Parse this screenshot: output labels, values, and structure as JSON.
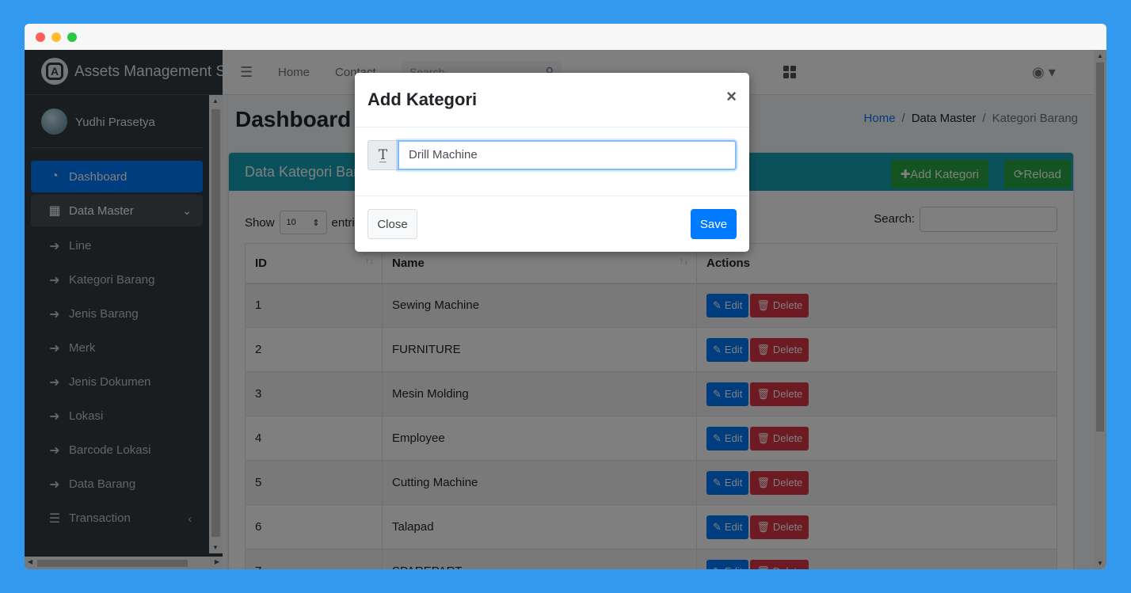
{
  "brand": {
    "title": "Assets Management Sys",
    "logo_letter": "A"
  },
  "user": {
    "name": "Yudhi Prasetya"
  },
  "sidebar": {
    "items": [
      {
        "label": "Dashboard",
        "icon": "tachometer-icon"
      },
      {
        "label": "Data Master",
        "icon": "table-icon"
      },
      {
        "label": "Line",
        "icon": "arrow-right-icon"
      },
      {
        "label": "Kategori Barang",
        "icon": "arrow-right-icon"
      },
      {
        "label": "Jenis Barang",
        "icon": "arrow-right-icon"
      },
      {
        "label": "Merk",
        "icon": "arrow-right-icon"
      },
      {
        "label": "Jenis Dokumen",
        "icon": "arrow-right-icon"
      },
      {
        "label": "Lokasi",
        "icon": "arrow-right-icon"
      },
      {
        "label": "Barcode Lokasi",
        "icon": "arrow-right-icon"
      },
      {
        "label": "Data Barang",
        "icon": "arrow-right-icon"
      },
      {
        "label": "Transaction",
        "icon": "list-icon"
      }
    ]
  },
  "topnav": {
    "home": "Home",
    "contact": "Contact",
    "search_placeholder": "Search"
  },
  "page": {
    "title": "Dashboard"
  },
  "breadcrumb": {
    "home": "Home",
    "sep": "/",
    "data_master": "Data Master",
    "current": "Kategori Barang"
  },
  "card": {
    "title": "Data Kategori Barang",
    "add_label": "Add Kategori",
    "reload_label": "Reload",
    "show": "Show",
    "entries_value": "10",
    "entries_suffix": "entries",
    "search_label": "Search:"
  },
  "table": {
    "headers": [
      "ID",
      "Name",
      "Actions"
    ],
    "edit_label": "Edit",
    "delete_label": "Delete",
    "rows": [
      {
        "id": "1",
        "name": "Sewing Machine"
      },
      {
        "id": "2",
        "name": "FURNITURE"
      },
      {
        "id": "3",
        "name": "Mesin Molding"
      },
      {
        "id": "4",
        "name": "Employee"
      },
      {
        "id": "5",
        "name": "Cutting Machine"
      },
      {
        "id": "6",
        "name": "Talapad"
      },
      {
        "id": "7",
        "name": "SPAREPART"
      }
    ]
  },
  "modal": {
    "title": "Add Kategori",
    "close_x": "×",
    "input_value": "Drill Machine",
    "close_label": "Close",
    "save_label": "Save"
  },
  "colors": {
    "sidebar_bg": "#343a40",
    "primary": "#007bff",
    "info": "#17a2b8",
    "success": "#28a745",
    "danger": "#dc3545"
  }
}
